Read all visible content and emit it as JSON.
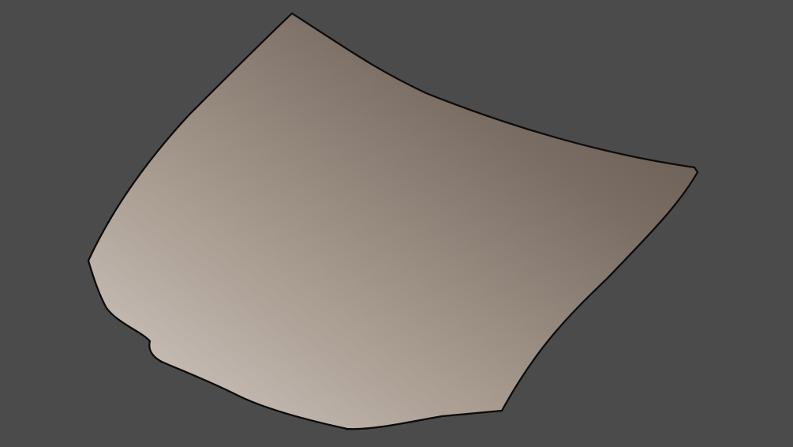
{
  "viewport": {
    "background_color": "#4b4b4b",
    "shading": "wireframe-on-shaded",
    "mesh": {
      "object": "car-hood",
      "surface_light_color": "#cfc8c2",
      "surface_mid_color": "#8b7d72",
      "surface_dark_color": "#5a4f47",
      "wire_color": "#1e1a17",
      "scoop_opening_color": "#1a1816"
    }
  }
}
